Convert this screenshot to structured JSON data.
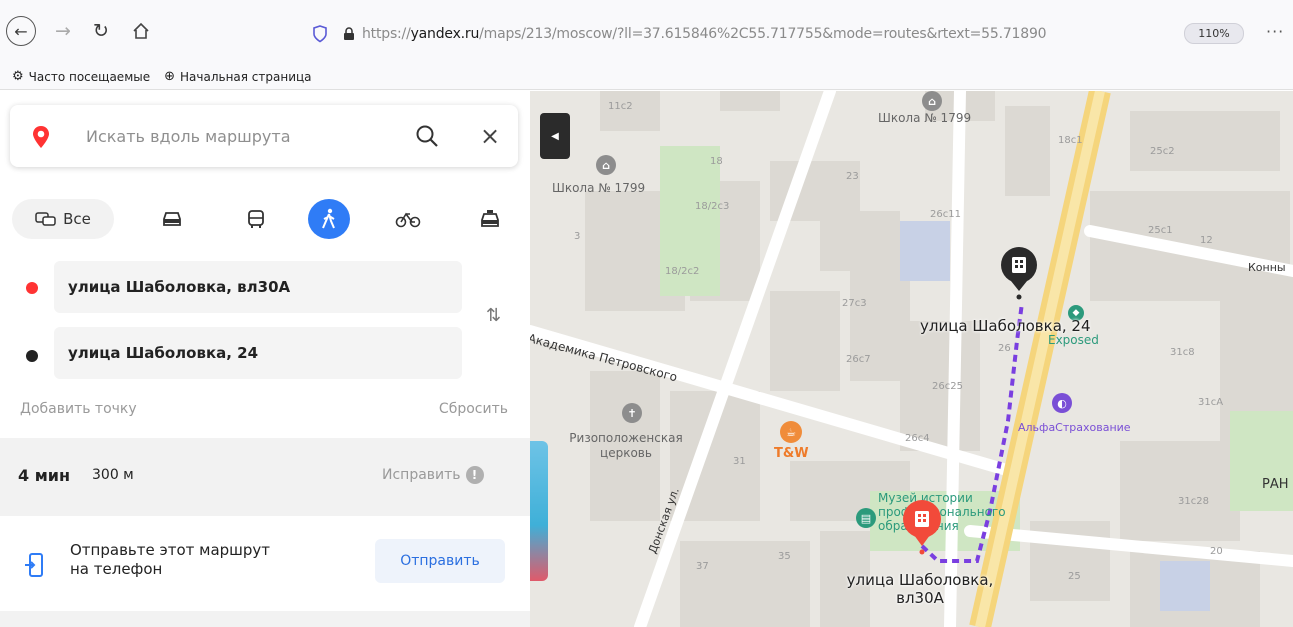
{
  "browser": {
    "url_prefix": "https://",
    "url_domain": "yandex.ru",
    "url_rest": "/maps/213/moscow/?ll=37.615846%2C55.717755&mode=routes&rtext=55.71890",
    "zoom": "110%",
    "more": "···",
    "bookmarks": [
      {
        "label": "Часто посещаемые",
        "icon": "gear-icon"
      },
      {
        "label": "Начальная страница",
        "icon": "globe-icon"
      }
    ]
  },
  "search": {
    "placeholder": "Искать вдоль маршрута"
  },
  "modes": {
    "all_label": "Все",
    "items": [
      "car-icon",
      "bus-icon",
      "pedestrian-icon",
      "bicycle-icon",
      "taxi-icon"
    ],
    "active": "pedestrian-icon"
  },
  "route": {
    "from": "улица Шаболовка, вл30А",
    "to": "улица Шаболовка, 24",
    "add_point": "Добавить точку",
    "reset": "Сбросить",
    "time": "4 мин",
    "distance": "300 м",
    "fix": "Исправить"
  },
  "send": {
    "text_line1": "Отправьте этот маршрут",
    "text_line2": "на телефон",
    "button": "Отправить"
  },
  "map": {
    "labels": {
      "school_left": "Школа № 1799",
      "school_top": "Школа № 1799",
      "street_petrovskogo": "Академика Петровского",
      "street_donskaya": "Донская ул.",
      "street_konna": "Конны",
      "church": "Ризоположенская церковь",
      "tw": "T&W",
      "museum": "Музей истории профессионального образования",
      "alfa": "АльфаСтрахование",
      "exposed": "Exposed",
      "destination": "улица Шаболовка, 24",
      "origin_line1": "улица Шаболовка,",
      "origin_line2": "вл30А",
      "pah": "РАН"
    },
    "house_numbers": [
      "11с2",
      "18",
      "18/2с3",
      "18/2с2",
      "23",
      "26с11",
      "27с3",
      "26с7",
      "26",
      "26с25",
      "26с4",
      "31",
      "35",
      "37",
      "25с2",
      "25с1",
      "12",
      "31с8",
      "31сА",
      "31с28",
      "18с1",
      "3",
      "20",
      "25"
    ]
  }
}
